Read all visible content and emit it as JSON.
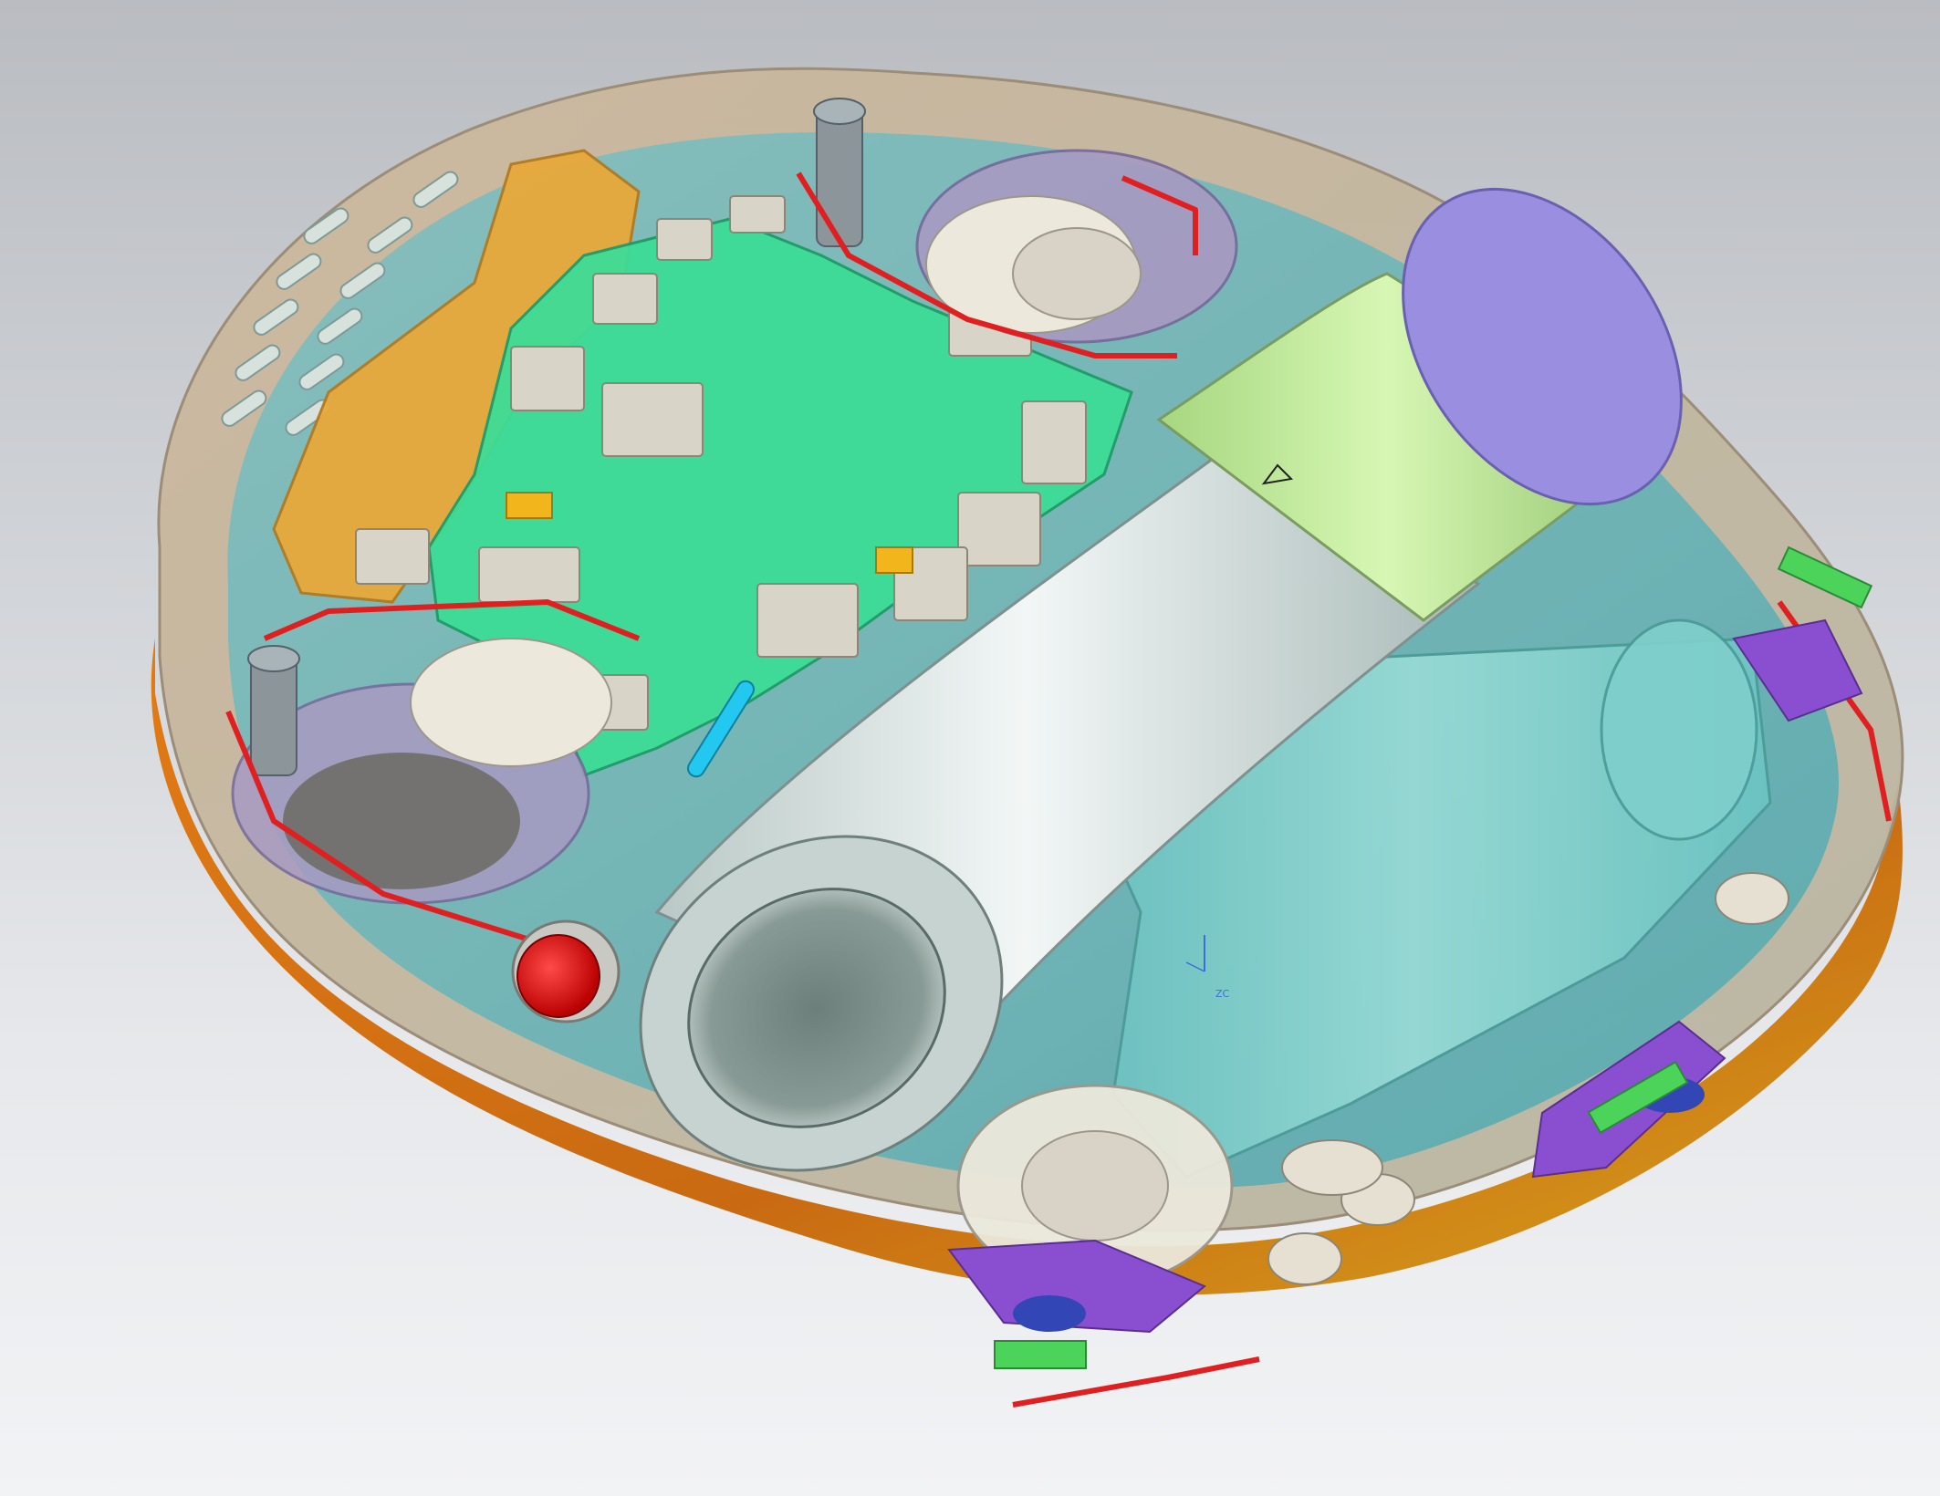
{
  "viewport": {
    "background_top": "#b9bcc0",
    "background_bottom": "#f2f3f5"
  },
  "colors": {
    "shell_tint": "#c8a98a",
    "inner_cavity": "#5fb6b6",
    "pcb": "#3ddc97",
    "bracket": "#e8a93a",
    "fan_lavender": "#a89ac2",
    "battery_silver": "#d8e4e4",
    "battery_green": "#c5ee9c",
    "battery_purple": "#9a8ee0",
    "tank": "#7fd0cc",
    "power_button": "#e10d0d",
    "wire": "#e02020",
    "purple_parts": "#8a4fd0",
    "green_connectors": "#4bd35a",
    "accent_blue": "#23c8f0",
    "orange_base": "#d9781f"
  },
  "view_triad": {
    "axis_label": "ZC"
  }
}
